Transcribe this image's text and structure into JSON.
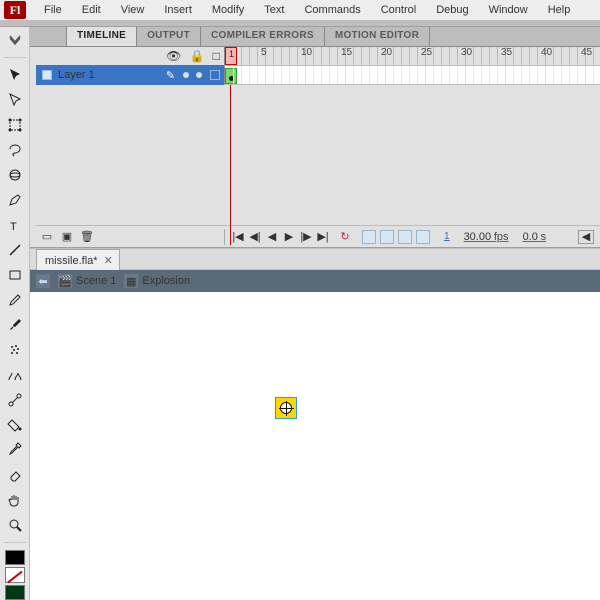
{
  "app_logo_text": "Fl",
  "menu": {
    "items": [
      "File",
      "Edit",
      "View",
      "Insert",
      "Modify",
      "Text",
      "Commands",
      "Control",
      "Debug",
      "Window",
      "Help"
    ]
  },
  "panels": {
    "tabs": [
      {
        "label": "TIMELINE",
        "active": true
      },
      {
        "label": "OUTPUT",
        "active": false
      },
      {
        "label": "COMPILER ERRORS",
        "active": false
      },
      {
        "label": "MOTION EDITOR",
        "active": false
      }
    ]
  },
  "timeline": {
    "ruler_labels": [
      1,
      5,
      10,
      15,
      20,
      25,
      30,
      35,
      40,
      45
    ],
    "layers": [
      {
        "name": "Layer 1"
      }
    ],
    "footer": {
      "current_frame": "1",
      "fps": "30.00",
      "fps_suffix": "fps",
      "elapsed": "0.0",
      "elapsed_suffix": "s"
    }
  },
  "tools": [
    "selection",
    "subselection",
    "free-transform",
    "lasso",
    "3d-rotation",
    "pen",
    "text",
    "line",
    "rectangle",
    "pencil",
    "brush",
    "brush2",
    "deco",
    "bone",
    "paint-bucket",
    "eyedropper",
    "eraser",
    "hand",
    "zoom"
  ],
  "document": {
    "filename": "missile.fla*"
  },
  "breadcrumb": {
    "back_icon": "back",
    "scene": "Scene 1",
    "symbol": "Explosion"
  },
  "colors": {
    "brand_red": "#a40000",
    "playhead": "#d40000",
    "layer_sel": "#3a74c4",
    "scene_bar": "#5a6a78"
  }
}
